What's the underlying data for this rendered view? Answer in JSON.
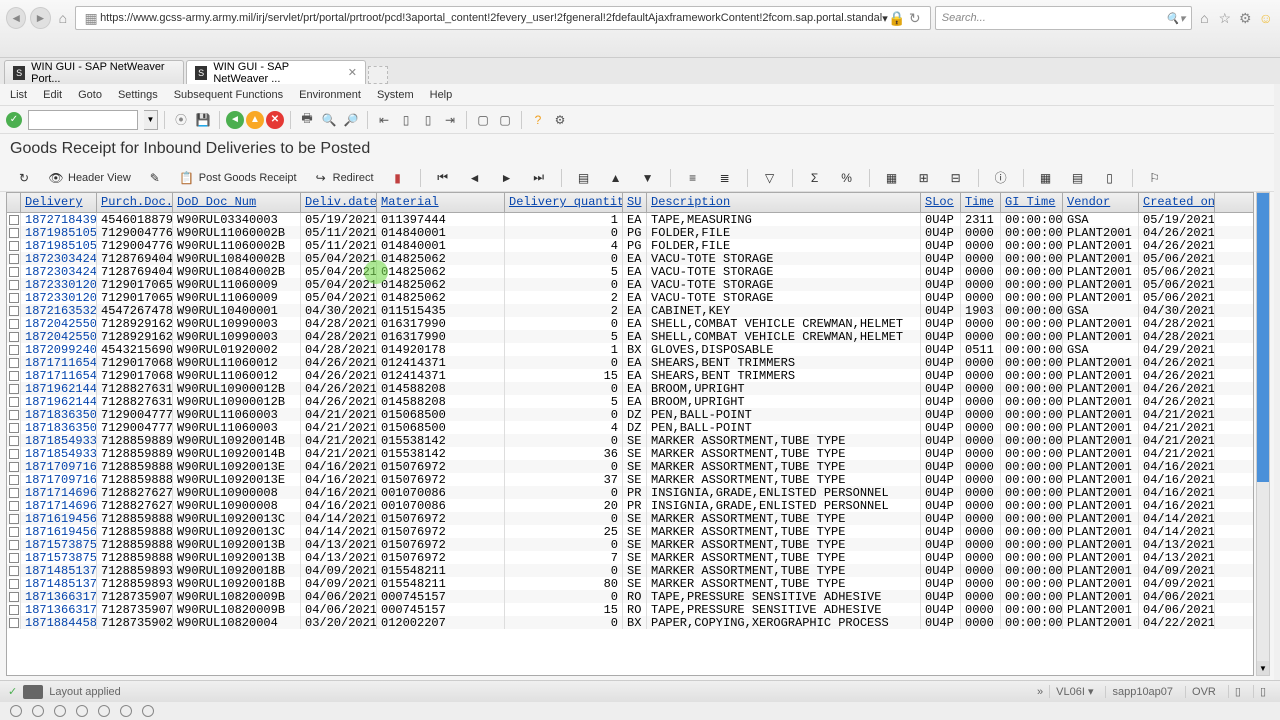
{
  "browser": {
    "url": "https://www.gcss-army.army.mil/irj/servlet/prt/portal/prtroot/pcd!3aportal_content!2fevery_user!2fgeneral!2fdefaultAjaxframeworkContent!2fcom.sap.portal.standal",
    "search_placeholder": "Search...",
    "tabs": [
      {
        "label": "WIN GUI - SAP NetWeaver Port..."
      },
      {
        "label": "WIN GUI - SAP NetWeaver ..."
      }
    ]
  },
  "sap": {
    "menu": [
      "List",
      "Edit",
      "Goto",
      "Settings",
      "Subsequent Functions",
      "Environment",
      "System",
      "Help"
    ],
    "title": "Goods Receipt for Inbound Deliveries to be Posted",
    "toolbar2": {
      "header_view": "Header View",
      "post_goods": "Post Goods Receipt",
      "redirect": "Redirect"
    },
    "columns": [
      "Delivery",
      "Purch.Doc.",
      "DoD Doc Num",
      "Deliv.date",
      "Material",
      "Delivery quantity",
      "SU",
      "Description",
      "SLoc",
      "Time",
      "GI Time",
      "Vendor",
      "Created on"
    ],
    "rows": [
      [
        "1872718439",
        "4546018879",
        "W90RUL03340003",
        "05/19/2021",
        "011397444",
        "1",
        "EA",
        "TAPE,MEASURING",
        "0U4P",
        "2311",
        "00:00:00",
        "GSA",
        "05/19/2021"
      ],
      [
        "1871985105",
        "7129004776",
        "W90RUL11060002B",
        "05/11/2021",
        "014840001",
        "0",
        "PG",
        "FOLDER,FILE",
        "0U4P",
        "0000",
        "00:00:00",
        "PLANT2001",
        "04/26/2021"
      ],
      [
        "1871985105",
        "7129004776",
        "W90RUL11060002B",
        "05/11/2021",
        "014840001",
        "4",
        "PG",
        "FOLDER,FILE",
        "0U4P",
        "0000",
        "00:00:00",
        "PLANT2001",
        "04/26/2021"
      ],
      [
        "1872303424",
        "7128769404",
        "W90RUL10840002B",
        "05/04/2021",
        "014825062",
        "0",
        "EA",
        "VACU-TOTE STORAGE",
        "0U4P",
        "0000",
        "00:00:00",
        "PLANT2001",
        "05/06/2021"
      ],
      [
        "1872303424",
        "7128769404",
        "W90RUL10840002B",
        "05/04/2021",
        "014825062",
        "5",
        "EA",
        "VACU-TOTE STORAGE",
        "0U4P",
        "0000",
        "00:00:00",
        "PLANT2001",
        "05/06/2021"
      ],
      [
        "1872330120",
        "7129017065",
        "W90RUL11060009",
        "05/04/2021",
        "014825062",
        "0",
        "EA",
        "VACU-TOTE STORAGE",
        "0U4P",
        "0000",
        "00:00:00",
        "PLANT2001",
        "05/06/2021"
      ],
      [
        "1872330120",
        "7129017065",
        "W90RUL11060009",
        "05/04/2021",
        "014825062",
        "2",
        "EA",
        "VACU-TOTE STORAGE",
        "0U4P",
        "0000",
        "00:00:00",
        "PLANT2001",
        "05/06/2021"
      ],
      [
        "1872163532",
        "4547267478",
        "W90RUL10400001",
        "04/30/2021",
        "011515435",
        "2",
        "EA",
        "CABINET,KEY",
        "0U4P",
        "1903",
        "00:00:00",
        "GSA",
        "04/30/2021"
      ],
      [
        "1872042550",
        "7128929162",
        "W90RUL10990003",
        "04/28/2021",
        "016317990",
        "0",
        "EA",
        "SHELL,COMBAT VEHICLE CREWMAN,HELMET",
        "0U4P",
        "0000",
        "00:00:00",
        "PLANT2001",
        "04/28/2021"
      ],
      [
        "1872042550",
        "7128929162",
        "W90RUL10990003",
        "04/28/2021",
        "016317990",
        "5",
        "EA",
        "SHELL,COMBAT VEHICLE CREWMAN,HELMET",
        "0U4P",
        "0000",
        "00:00:00",
        "PLANT2001",
        "04/28/2021"
      ],
      [
        "1872099240",
        "4543215690",
        "W90RUL01920002",
        "04/28/2021",
        "014920178",
        "1",
        "BX",
        "GLOVES,DISPOSABLE",
        "0U4P",
        "0511",
        "00:00:00",
        "GSA",
        "04/29/2021"
      ],
      [
        "1871711654",
        "7129017068",
        "W90RUL11060012",
        "04/26/2021",
        "012414371",
        "0",
        "EA",
        "SHEARS,BENT TRIMMERS",
        "0U4P",
        "0000",
        "00:00:00",
        "PLANT2001",
        "04/26/2021"
      ],
      [
        "1871711654",
        "7129017068",
        "W90RUL11060012",
        "04/26/2021",
        "012414371",
        "15",
        "EA",
        "SHEARS,BENT TRIMMERS",
        "0U4P",
        "0000",
        "00:00:00",
        "PLANT2001",
        "04/26/2021"
      ],
      [
        "1871962144",
        "7128827631",
        "W90RUL10900012B",
        "04/26/2021",
        "014588208",
        "0",
        "EA",
        "BROOM,UPRIGHT",
        "0U4P",
        "0000",
        "00:00:00",
        "PLANT2001",
        "04/26/2021"
      ],
      [
        "1871962144",
        "7128827631",
        "W90RUL10900012B",
        "04/26/2021",
        "014588208",
        "5",
        "EA",
        "BROOM,UPRIGHT",
        "0U4P",
        "0000",
        "00:00:00",
        "PLANT2001",
        "04/26/2021"
      ],
      [
        "1871836350",
        "7129004777",
        "W90RUL11060003",
        "04/21/2021",
        "015068500",
        "0",
        "DZ",
        "PEN,BALL-POINT",
        "0U4P",
        "0000",
        "00:00:00",
        "PLANT2001",
        "04/21/2021"
      ],
      [
        "1871836350",
        "7129004777",
        "W90RUL11060003",
        "04/21/2021",
        "015068500",
        "4",
        "DZ",
        "PEN,BALL-POINT",
        "0U4P",
        "0000",
        "00:00:00",
        "PLANT2001",
        "04/21/2021"
      ],
      [
        "1871854933",
        "7128859889",
        "W90RUL10920014B",
        "04/21/2021",
        "015538142",
        "0",
        "SE",
        "MARKER ASSORTMENT,TUBE TYPE",
        "0U4P",
        "0000",
        "00:00:00",
        "PLANT2001",
        "04/21/2021"
      ],
      [
        "1871854933",
        "7128859889",
        "W90RUL10920014B",
        "04/21/2021",
        "015538142",
        "36",
        "SE",
        "MARKER ASSORTMENT,TUBE TYPE",
        "0U4P",
        "0000",
        "00:00:00",
        "PLANT2001",
        "04/21/2021"
      ],
      [
        "1871709716",
        "7128859888",
        "W90RUL10920013E",
        "04/16/2021",
        "015076972",
        "0",
        "SE",
        "MARKER ASSORTMENT,TUBE TYPE",
        "0U4P",
        "0000",
        "00:00:00",
        "PLANT2001",
        "04/16/2021"
      ],
      [
        "1871709716",
        "7128859888",
        "W90RUL10920013E",
        "04/16/2021",
        "015076972",
        "37",
        "SE",
        "MARKER ASSORTMENT,TUBE TYPE",
        "0U4P",
        "0000",
        "00:00:00",
        "PLANT2001",
        "04/16/2021"
      ],
      [
        "1871714696",
        "7128827627",
        "W90RUL10900008",
        "04/16/2021",
        "001070086",
        "0",
        "PR",
        "INSIGNIA,GRADE,ENLISTED PERSONNEL",
        "0U4P",
        "0000",
        "00:00:00",
        "PLANT2001",
        "04/16/2021"
      ],
      [
        "1871714696",
        "7128827627",
        "W90RUL10900008",
        "04/16/2021",
        "001070086",
        "20",
        "PR",
        "INSIGNIA,GRADE,ENLISTED PERSONNEL",
        "0U4P",
        "0000",
        "00:00:00",
        "PLANT2001",
        "04/16/2021"
      ],
      [
        "1871619456",
        "7128859888",
        "W90RUL10920013C",
        "04/14/2021",
        "015076972",
        "0",
        "SE",
        "MARKER ASSORTMENT,TUBE TYPE",
        "0U4P",
        "0000",
        "00:00:00",
        "PLANT2001",
        "04/14/2021"
      ],
      [
        "1871619456",
        "7128859888",
        "W90RUL10920013C",
        "04/14/2021",
        "015076972",
        "25",
        "SE",
        "MARKER ASSORTMENT,TUBE TYPE",
        "0U4P",
        "0000",
        "00:00:00",
        "PLANT2001",
        "04/14/2021"
      ],
      [
        "1871573875",
        "7128859888",
        "W90RUL10920013B",
        "04/13/2021",
        "015076972",
        "0",
        "SE",
        "MARKER ASSORTMENT,TUBE TYPE",
        "0U4P",
        "0000",
        "00:00:00",
        "PLANT2001",
        "04/13/2021"
      ],
      [
        "1871573875",
        "7128859888",
        "W90RUL10920013B",
        "04/13/2021",
        "015076972",
        "7",
        "SE",
        "MARKER ASSORTMENT,TUBE TYPE",
        "0U4P",
        "0000",
        "00:00:00",
        "PLANT2001",
        "04/13/2021"
      ],
      [
        "1871485137",
        "7128859893",
        "W90RUL10920018B",
        "04/09/2021",
        "015548211",
        "0",
        "SE",
        "MARKER ASSORTMENT,TUBE TYPE",
        "0U4P",
        "0000",
        "00:00:00",
        "PLANT2001",
        "04/09/2021"
      ],
      [
        "1871485137",
        "7128859893",
        "W90RUL10920018B",
        "04/09/2021",
        "015548211",
        "80",
        "SE",
        "MARKER ASSORTMENT,TUBE TYPE",
        "0U4P",
        "0000",
        "00:00:00",
        "PLANT2001",
        "04/09/2021"
      ],
      [
        "1871366317",
        "7128735907",
        "W90RUL10820009B",
        "04/06/2021",
        "000745157",
        "0",
        "RO",
        "TAPE,PRESSURE SENSITIVE ADHESIVE",
        "0U4P",
        "0000",
        "00:00:00",
        "PLANT2001",
        "04/06/2021"
      ],
      [
        "1871366317",
        "7128735907",
        "W90RUL10820009B",
        "04/06/2021",
        "000745157",
        "15",
        "RO",
        "TAPE,PRESSURE SENSITIVE ADHESIVE",
        "0U4P",
        "0000",
        "00:00:00",
        "PLANT2001",
        "04/06/2021"
      ],
      [
        "1871884458",
        "7128735902",
        "W90RUL10820004",
        "03/20/2021",
        "012002207",
        "0",
        "BX",
        "PAPER,COPYING,XEROGRAPHIC PROCESS",
        "0U4P",
        "0000",
        "00:00:00",
        "PLANT2001",
        "04/22/2021"
      ]
    ],
    "status": {
      "left": "Layout applied",
      "tcode": "VL06I",
      "server": "sapp10ap07",
      "mode": "OVR"
    }
  }
}
